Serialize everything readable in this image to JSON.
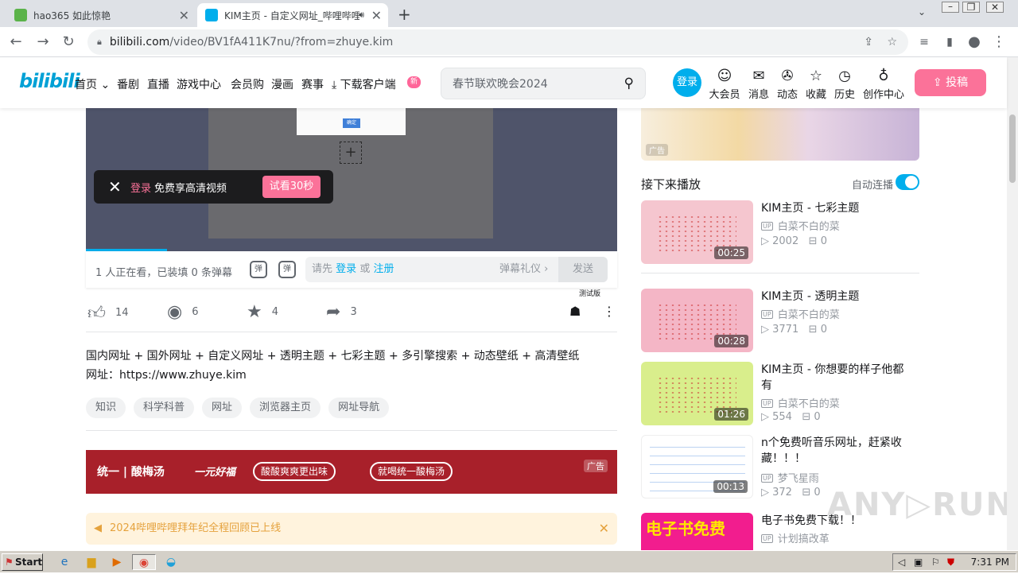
{
  "browser": {
    "tabs": [
      {
        "title": "hao365 如此惊艳",
        "active": false
      },
      {
        "title": "KIM主页 - 自定义网址_哔哩哔哩",
        "active": true
      }
    ],
    "new_tab": "+",
    "url_host": "bilibili.com",
    "url_path": "/video/BV1fA411K7nu/?from=zhuye.kim"
  },
  "header": {
    "logo": "bilibili",
    "nav": [
      "首页",
      "番剧",
      "直播",
      "游戏中心",
      "会员购",
      "漫画",
      "赛事",
      "下载客户端"
    ],
    "new_badge": "新",
    "search_placeholder": "春节联欢晚会2024",
    "login": "登录",
    "icons": [
      {
        "label": "大会员",
        "glyph": "☺"
      },
      {
        "label": "消息",
        "glyph": "✉"
      },
      {
        "label": "动态",
        "glyph": "✇"
      },
      {
        "label": "收藏",
        "glyph": "☆"
      },
      {
        "label": "历史",
        "glyph": "◷"
      },
      {
        "label": "创作中心",
        "glyph": "♁"
      }
    ],
    "upload": "投稿"
  },
  "player": {
    "ok_label": "确定",
    "login_banner": {
      "login": "登录",
      "text": "免费享高清视频",
      "try": "试看30秒"
    },
    "watching": "1 人正在看，已装填 0 条弹幕",
    "dm_prefix": "请先",
    "dm_login": "登录",
    "dm_or": "或",
    "dm_register": "注册",
    "dm_etiquette": "弹幕礼仪 ›",
    "send": "发送"
  },
  "actions": {
    "like": "14",
    "coin": "6",
    "fav": "4",
    "share": "3",
    "beta": "测试版"
  },
  "description": {
    "line1": "国内网址 + 国外网址 + 自定义网址 + 透明主题 + 七彩主题 + 多引擎搜索 + 动态壁纸 + 高清壁纸",
    "line2": "网址：https://www.zhuye.kim"
  },
  "tags": [
    "知识",
    "科学科普",
    "网址",
    "浏览器主页",
    "网址导航"
  ],
  "ad": {
    "brand": "统一 | 酸梅汤",
    "brand2": "一元好福",
    "slogan1": "酸酸爽爽更出味",
    "slogan2": "就喝统一酸梅汤",
    "label": "广告"
  },
  "notice": "2024哔哩哔哩拜年纪全程回顾已上线",
  "right": {
    "top_ad_label": "广告",
    "up_next": "接下来播放",
    "autoplay": "自动连播",
    "cards": [
      {
        "title": "KIM主页 - 七彩主题",
        "up": "白菜不白的菜",
        "views": "2002",
        "danmaku": "0",
        "duration": "00:25",
        "color": "#f5c6cf"
      },
      {
        "title": "KIM主页 - 透明主题",
        "up": "白菜不白的菜",
        "views": "3771",
        "danmaku": "0",
        "duration": "00:28",
        "color": "#f4b6c6"
      },
      {
        "title": "KIM主页 - 你想要的样子他都有",
        "up": "白菜不白的菜",
        "views": "554",
        "danmaku": "0",
        "duration": "01:26",
        "color": "#d9ee8c"
      },
      {
        "title": "n个免费听音乐网址，赶紧收藏！！！",
        "up": "梦飞星雨",
        "views": "372",
        "danmaku": "0",
        "duration": "00:13",
        "color": "#ffffff"
      },
      {
        "title": "电子书免费下载！！",
        "up": "计划搞改革",
        "views": "",
        "danmaku": "",
        "duration": "",
        "color": "#f21d8e"
      }
    ]
  },
  "taskbar": {
    "start": "Start",
    "clock": "7:31 PM"
  }
}
